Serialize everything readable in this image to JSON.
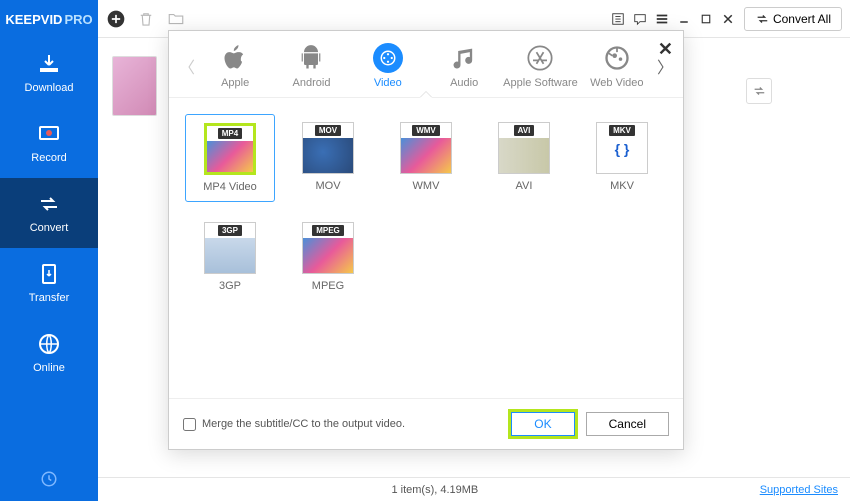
{
  "logo": {
    "brand": "KEEPVID",
    "suffix": "PRO"
  },
  "sidebar": {
    "items": [
      {
        "label": "Download"
      },
      {
        "label": "Record"
      },
      {
        "label": "Convert"
      },
      {
        "label": "Transfer"
      },
      {
        "label": "Online"
      }
    ]
  },
  "topbar": {
    "convert_all": "Convert All"
  },
  "modal": {
    "tabs": [
      {
        "label": "Apple"
      },
      {
        "label": "Android"
      },
      {
        "label": "Video"
      },
      {
        "label": "Audio"
      },
      {
        "label": "Apple Software"
      },
      {
        "label": "Web Video"
      }
    ],
    "formats": [
      {
        "tag": "MP4",
        "label": "MP4 Video",
        "selected": true,
        "style": "mp4"
      },
      {
        "tag": "MOV",
        "label": "MOV",
        "style": "mov"
      },
      {
        "tag": "WMV",
        "label": "WMV",
        "style": "mp4"
      },
      {
        "tag": "AVI",
        "label": "AVI",
        "style": "avi"
      },
      {
        "tag": "MKV",
        "label": "MKV",
        "style": "mkv"
      },
      {
        "tag": "3GP",
        "label": "3GP",
        "style": "gp"
      },
      {
        "tag": "MPEG",
        "label": "MPEG",
        "style": "mp4"
      }
    ],
    "merge_label": "Merge the subtitle/CC to the output video.",
    "ok": "OK",
    "cancel": "Cancel"
  },
  "status": {
    "summary": "1 item(s), 4.19MB",
    "link": "Supported Sites"
  }
}
